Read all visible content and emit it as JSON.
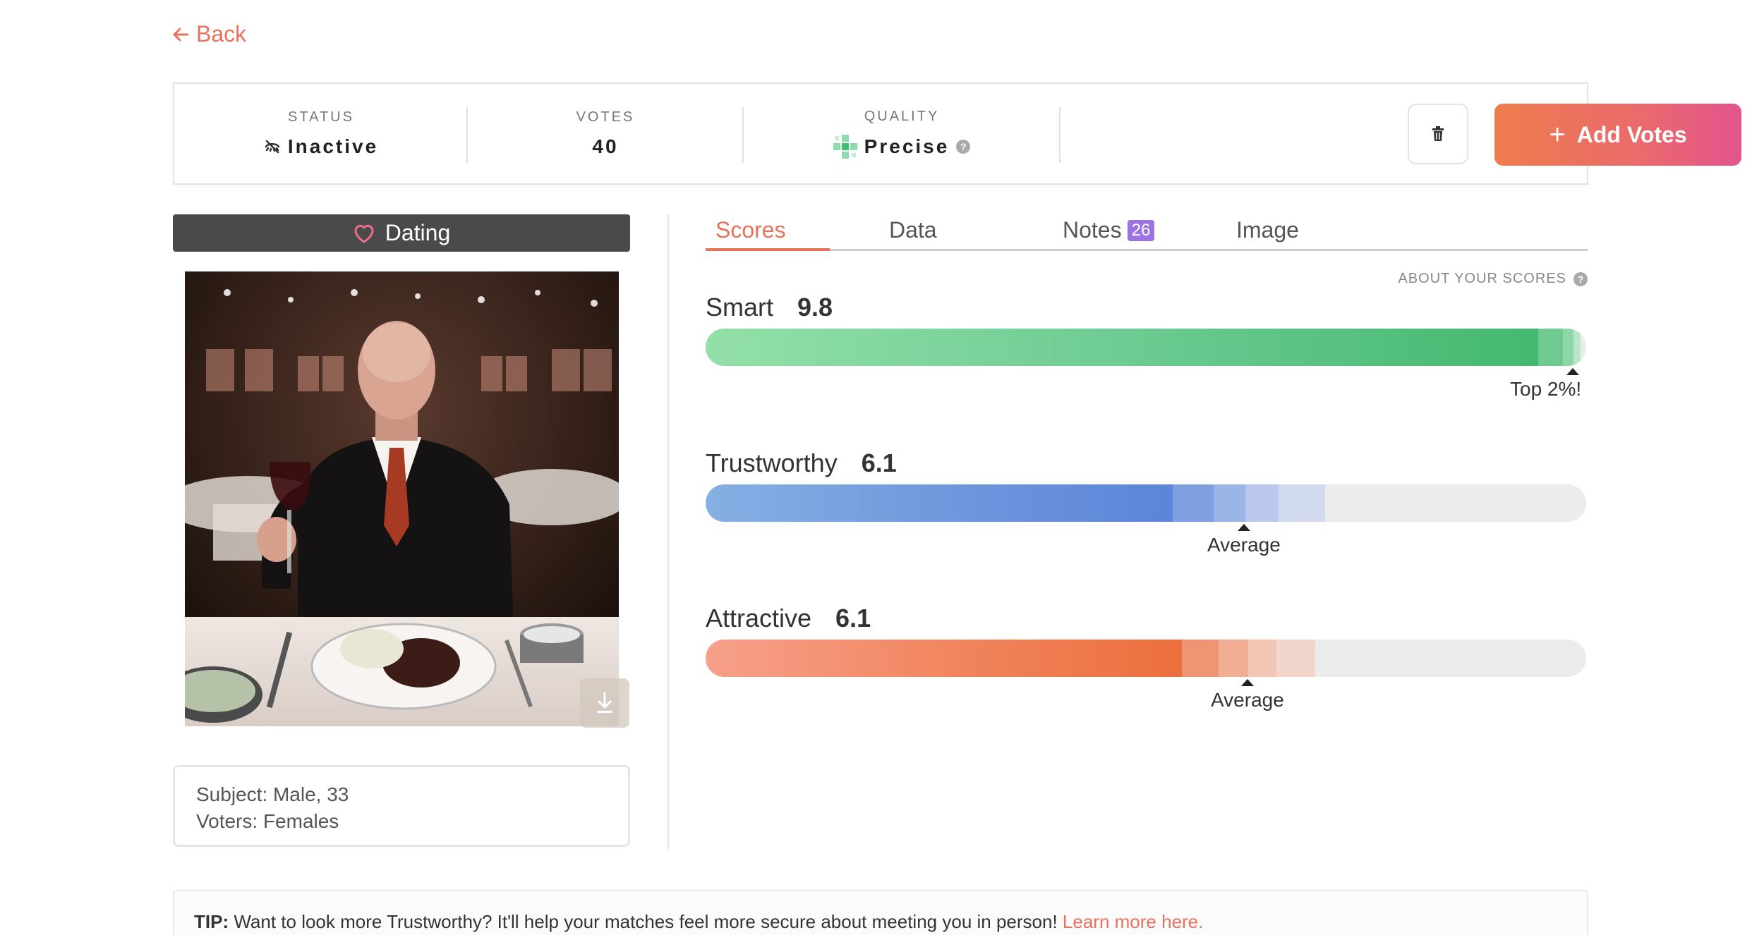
{
  "nav": {
    "back_label": "Back"
  },
  "status_card": {
    "status_label": "STATUS",
    "status_value": "Inactive",
    "votes_label": "VOTES",
    "votes_value": "40",
    "quality_label": "QUALITY",
    "quality_value": "Precise",
    "add_votes_label": "Add Votes"
  },
  "category": {
    "label": "Dating"
  },
  "subject": {
    "line1": "Subject: Male, 33",
    "line2": "Voters: Females"
  },
  "tabs": [
    {
      "label": "Scores"
    },
    {
      "label": "Data"
    },
    {
      "label": "Notes",
      "badge": "26"
    },
    {
      "label": "Image"
    }
  ],
  "about_scores_label": "ABOUT YOUR SCORES",
  "scores": [
    {
      "label": "Smart",
      "value": "9.8",
      "fraction": 0.98,
      "marker_label": "Top 2%!"
    },
    {
      "label": "Trustworthy",
      "value": "6.1",
      "fraction": 0.61,
      "marker_label": "Average"
    },
    {
      "label": "Attractive",
      "value": "6.1",
      "fraction": 0.61,
      "marker_label": "Average"
    }
  ],
  "tip": {
    "prefix": "TIP:",
    "text": "Want to look more Trustworthy? It'll help your matches feel more secure about meeting you in person!",
    "link": "Learn more here."
  },
  "colors": {
    "accent": "#e8735a",
    "smart": "#44b870",
    "trustworthy": "#5b86d9",
    "attractive": "#ec6f3d",
    "badge": "#9b73e2"
  }
}
